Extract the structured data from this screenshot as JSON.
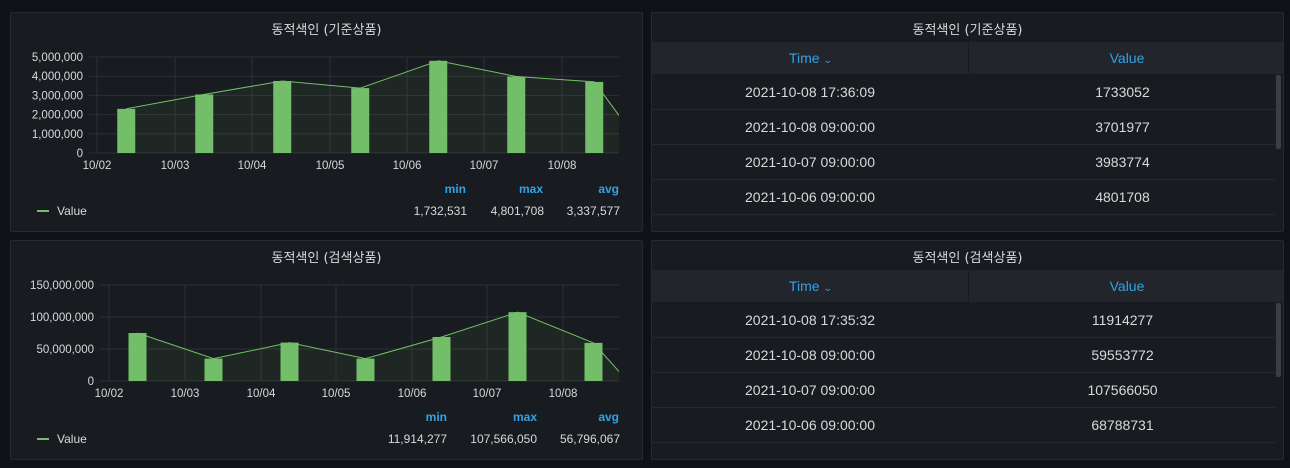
{
  "colors": {
    "series": "#73bf69",
    "accent": "#33a2e5",
    "panel": "#181b1f",
    "background": "#111217"
  },
  "panels": {
    "graph1": {
      "title": "동적색인 (기준상품)",
      "legend": {
        "series_name": "Value",
        "min_label": "min",
        "max_label": "max",
        "avg_label": "avg",
        "min": "1,732,531",
        "max": "4,801,708",
        "avg": "3,337,577"
      }
    },
    "graph2": {
      "title": "동적색인 (검색상품)",
      "legend": {
        "series_name": "Value",
        "min_label": "min",
        "max_label": "max",
        "avg_label": "avg",
        "min": "11,914,277",
        "max": "107,566,050",
        "avg": "56,796,067"
      }
    },
    "table1": {
      "title": "동적색인 (기준상품)",
      "columns": [
        "Time",
        "Value"
      ],
      "rows": [
        [
          "2021-10-08 17:36:09",
          "1733052"
        ],
        [
          "2021-10-08 09:00:00",
          "3701977"
        ],
        [
          "2021-10-07 09:00:00",
          "3983774"
        ],
        [
          "2021-10-06 09:00:00",
          "4801708"
        ]
      ]
    },
    "table2": {
      "title": "동적색인 (검색상품)",
      "columns": [
        "Time",
        "Value"
      ],
      "rows": [
        [
          "2021-10-08 17:35:32",
          "11914277"
        ],
        [
          "2021-10-08 09:00:00",
          "59553772"
        ],
        [
          "2021-10-07 09:00:00",
          "107566050"
        ],
        [
          "2021-10-06 09:00:00",
          "68788731"
        ]
      ]
    }
  },
  "chart_data": [
    {
      "type": "bar",
      "title": "동적색인 (기준상품)",
      "x_tick_labels": [
        "10/02",
        "10/03",
        "10/04",
        "10/05",
        "10/06",
        "10/07",
        "10/08"
      ],
      "y_tick_labels": [
        "0",
        "1,000,000",
        "2,000,000",
        "3,000,000",
        "4,000,000",
        "5,000,000"
      ],
      "ylim": [
        0,
        5000000
      ],
      "grid": true,
      "legend_position": "bottom",
      "bar_dates": [
        "2021-10-02 09:00",
        "2021-10-03 09:00",
        "2021-10-04 09:00",
        "2021-10-05 09:00",
        "2021-10-06 09:00",
        "2021-10-07 09:00",
        "2021-10-08 09:00"
      ],
      "series": [
        {
          "name": "Value",
          "values": [
            2300000,
            3050000,
            3750000,
            3380000,
            4801708,
            3983774,
            3701977
          ]
        }
      ],
      "line_end": {
        "date": "2021-10-08 17:36",
        "value": 1733052
      }
    },
    {
      "type": "bar",
      "title": "동적색인 (검색상품)",
      "x_tick_labels": [
        "10/02",
        "10/03",
        "10/04",
        "10/05",
        "10/06",
        "10/07",
        "10/08"
      ],
      "y_tick_labels": [
        "0",
        "50,000,000",
        "100,000,000",
        "150,000,000"
      ],
      "ylim": [
        0,
        150000000
      ],
      "grid": true,
      "legend_position": "bottom",
      "bar_dates": [
        "2021-10-02 09:00",
        "2021-10-03 09:00",
        "2021-10-04 09:00",
        "2021-10-05 09:00",
        "2021-10-06 09:00",
        "2021-10-07 09:00",
        "2021-10-08 09:00"
      ],
      "series": [
        {
          "name": "Value",
          "values": [
            75000000,
            35000000,
            60000000,
            35000000,
            68788731,
            107566050,
            59553772
          ]
        }
      ],
      "line_end": {
        "date": "2021-10-08 17:35",
        "value": 11914277
      }
    }
  ]
}
